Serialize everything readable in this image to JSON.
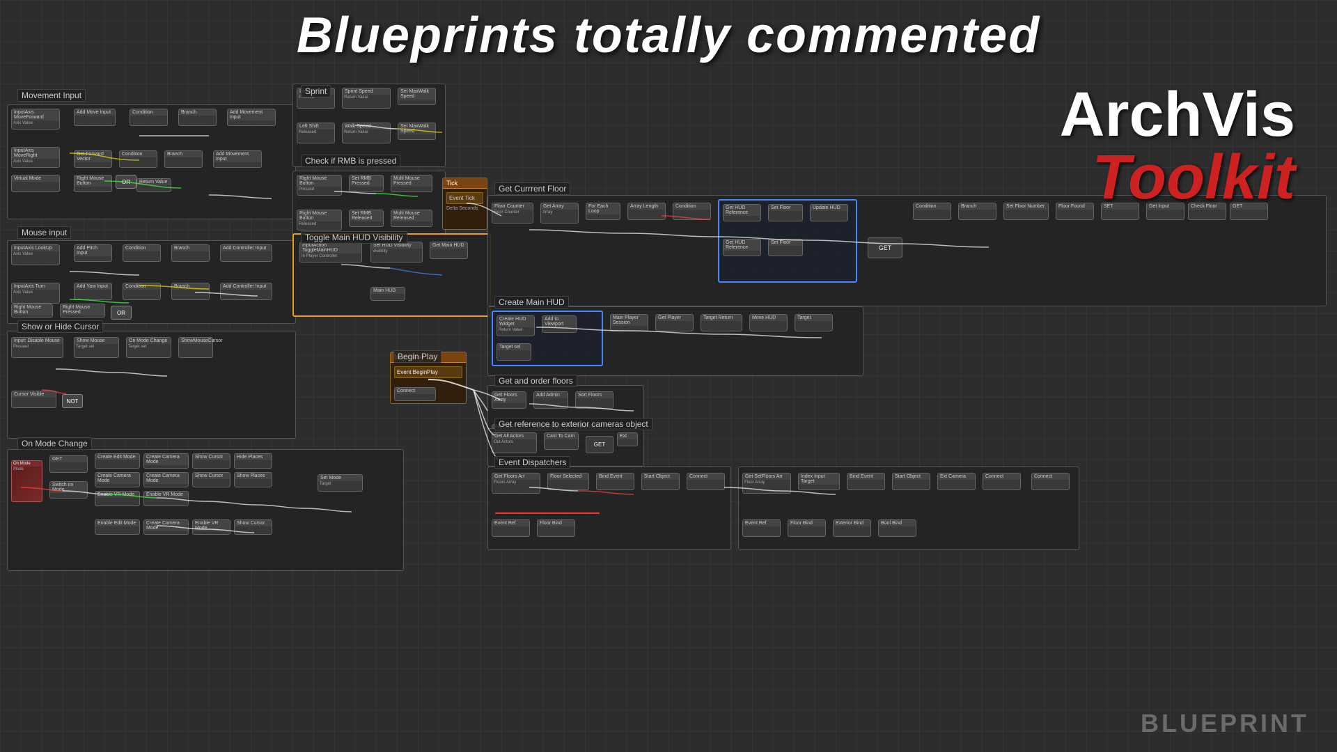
{
  "page": {
    "title": "Blueprints totally commented",
    "logo": {
      "arch": "ArchVis",
      "toolkit": "Toolkit"
    },
    "watermark": "BLUEPRINT"
  },
  "sections": {
    "movement_input": "Movement Input",
    "mouse_input": "Mouse input",
    "show_hide_cursor": "Show or Hide Cursor",
    "on_mode_change": "On Mode Change",
    "sprint": "Sprint",
    "check_rmb": "Check if RMB is pressed",
    "toggle_hud": "Toggle Main HUD Visibility",
    "tick": "Tick",
    "get_current_floor": "Get Currrent Floor",
    "create_main_hud": "Create Main HUD",
    "begin_play": "Begin Play",
    "get_order_floors": "Get and order floors",
    "get_reference": "Get reference to exterior cameras object",
    "event_dispatchers": "Event Dispatchers"
  },
  "colors": {
    "orange_border": "#e8a020",
    "node_orange": "#8B4513",
    "section_bg": "#2d2d2d",
    "grid_line": "rgba(255,255,255,0.04)",
    "accent_red": "#cc2222",
    "text_white": "#ffffff",
    "text_gray": "#cccccc"
  }
}
